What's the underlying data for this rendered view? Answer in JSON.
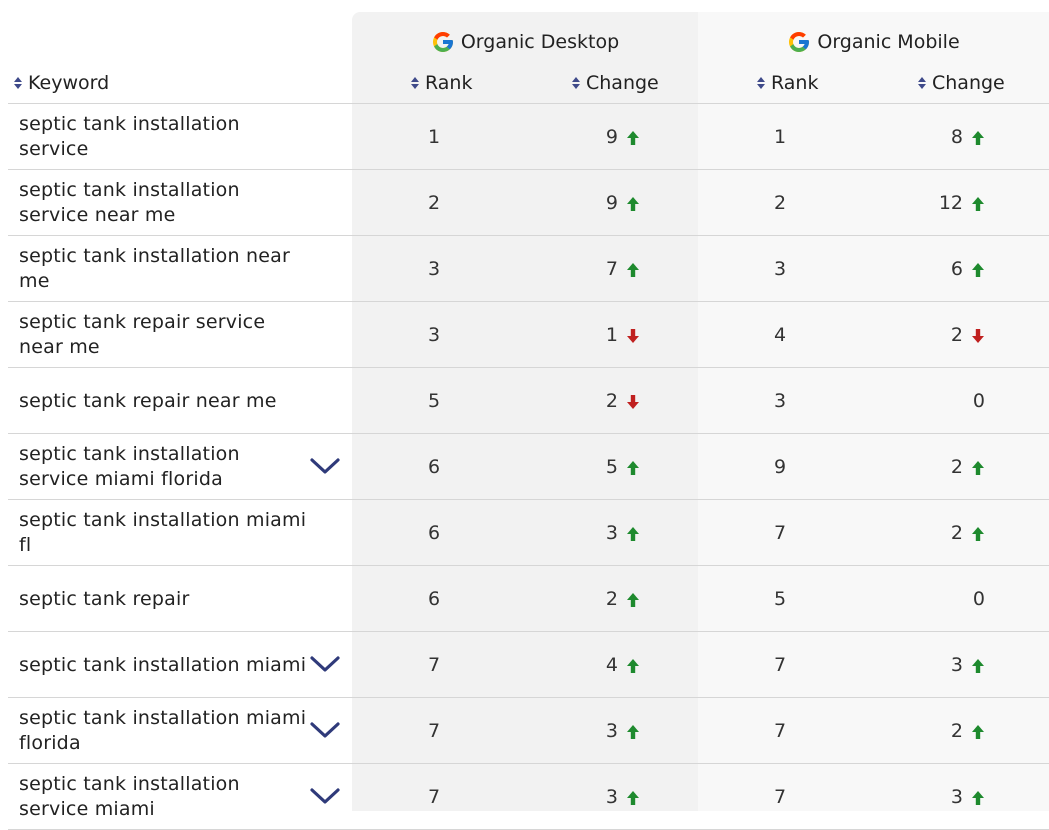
{
  "groups": {
    "desktop": "Organic Desktop",
    "mobile": "Organic Mobile"
  },
  "headers": {
    "keyword": "Keyword",
    "rank": "Rank",
    "change": "Change"
  },
  "colors": {
    "up": "#1e8a2e",
    "down": "#c0201f",
    "chevron": "#2f3a7a"
  },
  "rows": [
    {
      "keyword": "septic tank installation service",
      "expandable": false,
      "d_rank": "1",
      "d_change": "9",
      "d_dir": "up",
      "m_rank": "1",
      "m_change": "8",
      "m_dir": "up"
    },
    {
      "keyword": "septic tank installation service near me",
      "expandable": false,
      "d_rank": "2",
      "d_change": "9",
      "d_dir": "up",
      "m_rank": "2",
      "m_change": "12",
      "m_dir": "up"
    },
    {
      "keyword": "septic tank installation near me",
      "expandable": false,
      "d_rank": "3",
      "d_change": "7",
      "d_dir": "up",
      "m_rank": "3",
      "m_change": "6",
      "m_dir": "up"
    },
    {
      "keyword": "septic tank repair service near me",
      "expandable": false,
      "d_rank": "3",
      "d_change": "1",
      "d_dir": "down",
      "m_rank": "4",
      "m_change": "2",
      "m_dir": "down"
    },
    {
      "keyword": "septic tank repair near me",
      "expandable": false,
      "d_rank": "5",
      "d_change": "2",
      "d_dir": "down",
      "m_rank": "3",
      "m_change": "0",
      "m_dir": "none"
    },
    {
      "keyword": "septic tank installation service miami florida",
      "expandable": true,
      "d_rank": "6",
      "d_change": "5",
      "d_dir": "up",
      "m_rank": "9",
      "m_change": "2",
      "m_dir": "up"
    },
    {
      "keyword": "septic tank installation miami fl",
      "expandable": false,
      "d_rank": "6",
      "d_change": "3",
      "d_dir": "up",
      "m_rank": "7",
      "m_change": "2",
      "m_dir": "up"
    },
    {
      "keyword": "septic tank repair",
      "expandable": false,
      "d_rank": "6",
      "d_change": "2",
      "d_dir": "up",
      "m_rank": "5",
      "m_change": "0",
      "m_dir": "none"
    },
    {
      "keyword": "septic tank installation miami",
      "expandable": true,
      "d_rank": "7",
      "d_change": "4",
      "d_dir": "up",
      "m_rank": "7",
      "m_change": "3",
      "m_dir": "up"
    },
    {
      "keyword": "septic tank installation miami florida",
      "expandable": true,
      "d_rank": "7",
      "d_change": "3",
      "d_dir": "up",
      "m_rank": "7",
      "m_change": "2",
      "m_dir": "up"
    },
    {
      "keyword": "septic tank installation service miami",
      "expandable": true,
      "d_rank": "7",
      "d_change": "3",
      "d_dir": "up",
      "m_rank": "7",
      "m_change": "3",
      "m_dir": "up"
    }
  ]
}
